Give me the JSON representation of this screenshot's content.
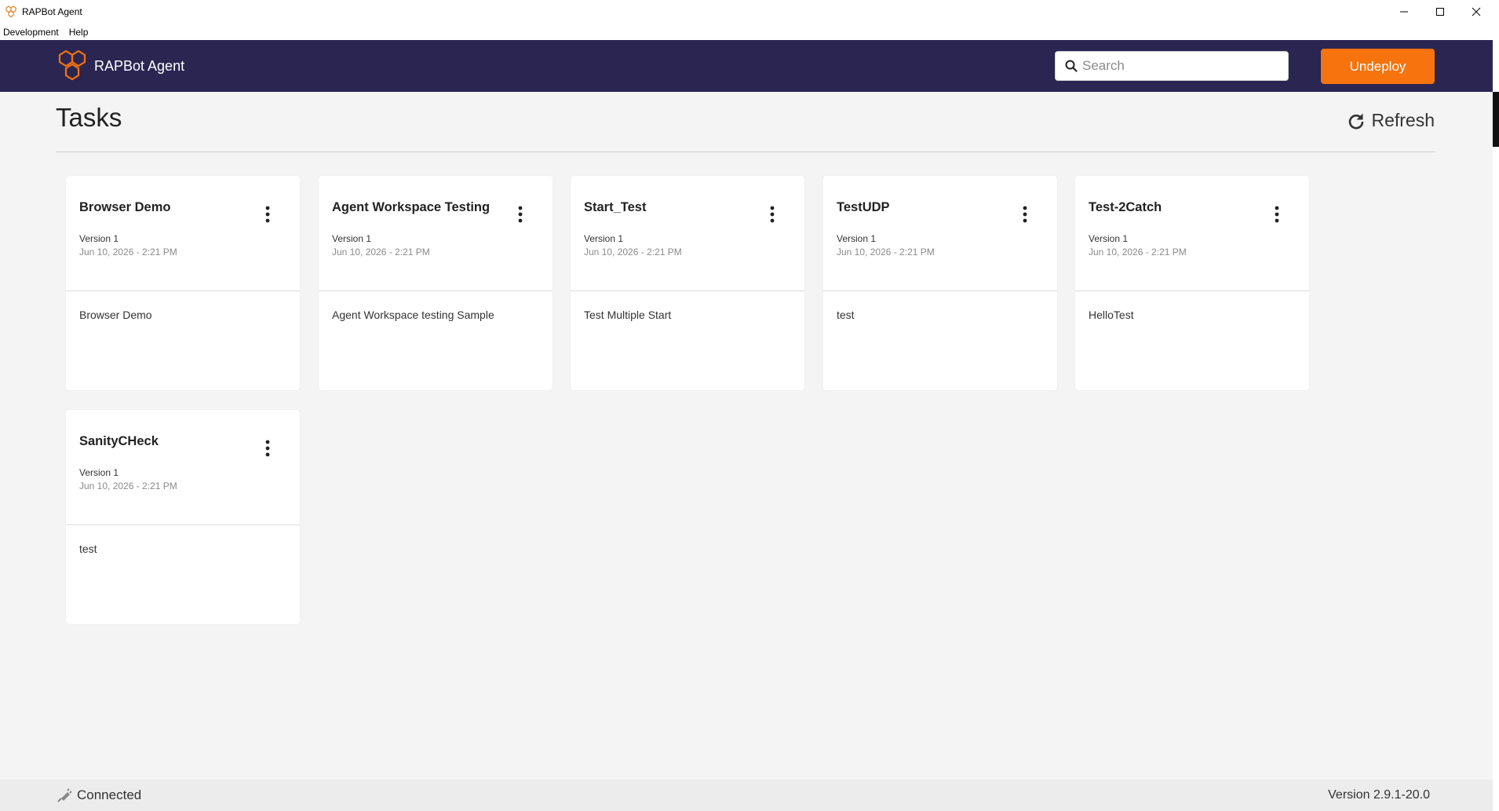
{
  "window": {
    "title": "RAPBot Agent"
  },
  "menu": {
    "items": [
      "Development",
      "Help"
    ]
  },
  "header": {
    "brand": "RAPBot Agent",
    "search_placeholder": "Search",
    "undeploy_label": "Undeploy"
  },
  "main": {
    "title": "Tasks",
    "refresh_label": "Refresh",
    "cards": [
      {
        "title": "Browser Demo",
        "version": "Version 1",
        "date": "Jun 10, 2026 - 2:21 PM",
        "description": "Browser Demo"
      },
      {
        "title": "Agent Workspace Testing",
        "version": "Version 1",
        "date": "Jun 10, 2026 - 2:21 PM",
        "description": "Agent Workspace testing Sample"
      },
      {
        "title": "Start_Test",
        "version": "Version 1",
        "date": "Jun 10, 2026 - 2:21 PM",
        "description": "Test Multiple Start"
      },
      {
        "title": "TestUDP",
        "version": "Version 1",
        "date": "Jun 10, 2026 - 2:21 PM",
        "description": "test"
      },
      {
        "title": "Test-2Catch",
        "version": "Version 1",
        "date": "Jun 10, 2026 - 2:21 PM",
        "description": "HelloTest"
      },
      {
        "title": "SanityCHeck",
        "version": "Version 1",
        "date": "Jun 10, 2026 - 2:21 PM",
        "description": "test"
      }
    ]
  },
  "status": {
    "connection": "Connected",
    "version": "Version 2.9.1-20.0"
  },
  "colors": {
    "header_bg": "#2b2552",
    "accent": "#f7730d"
  }
}
